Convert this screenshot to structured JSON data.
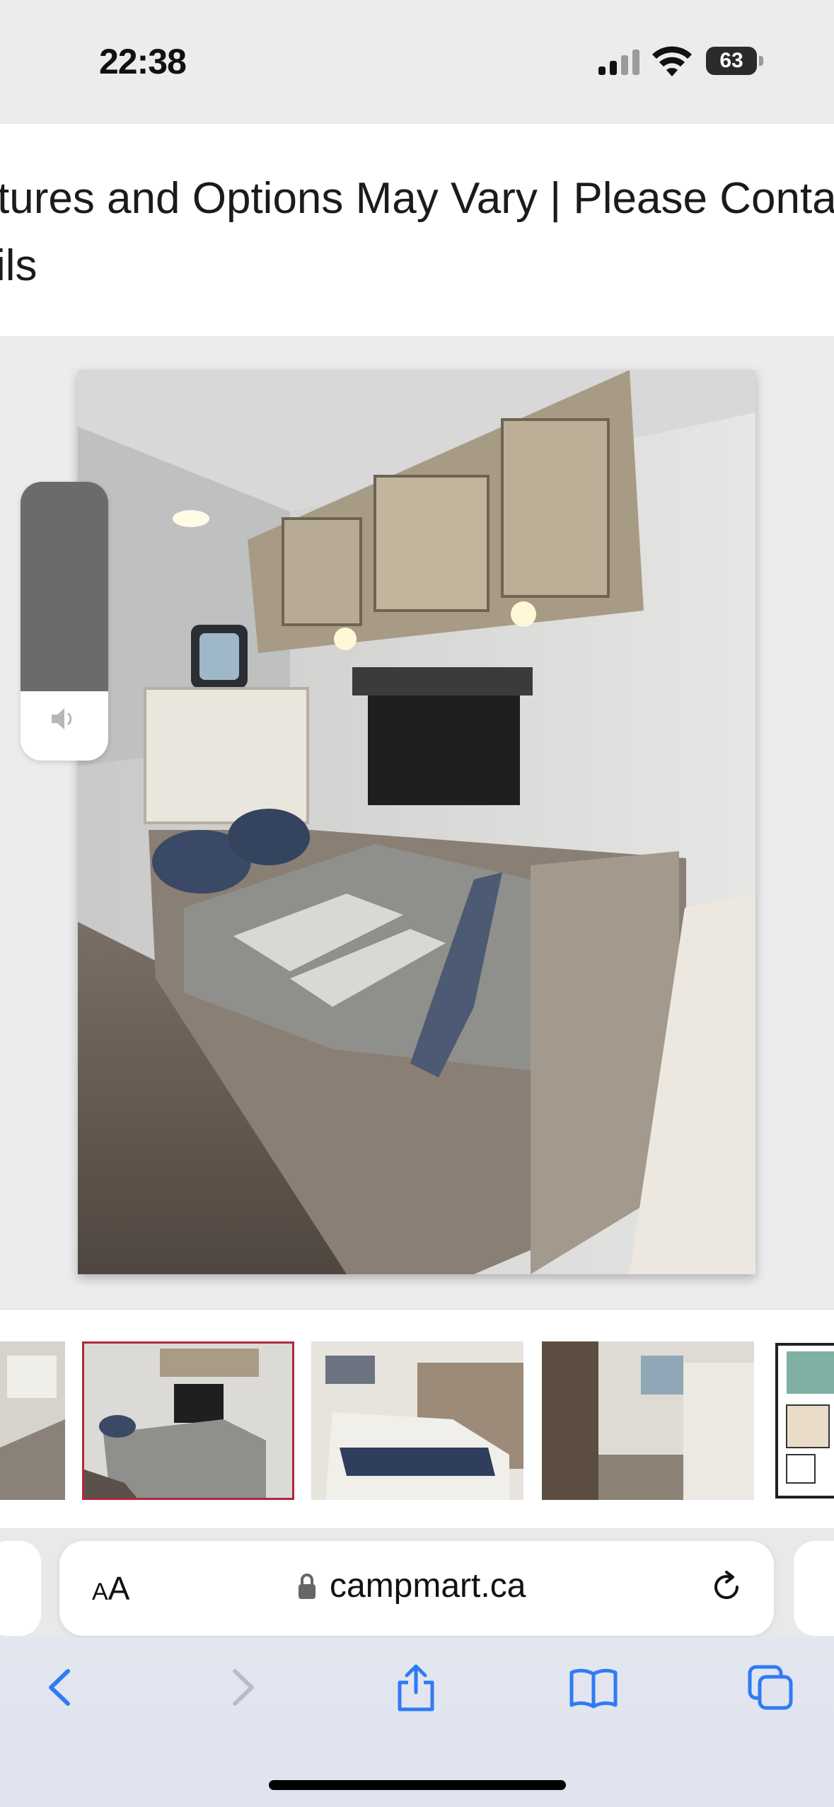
{
  "status_bar": {
    "time": "22:38",
    "battery_level": "63"
  },
  "banner": {
    "line1": "tures and Options May Vary | Please Contact",
    "line2": "ils"
  },
  "volume_hud": {
    "level": 0.75
  },
  "gallery": {
    "selected_index": 1,
    "thumbnail_count": 5
  },
  "url_bar": {
    "reader_label_small": "A",
    "reader_label_large": "A",
    "url": "campmart.ca"
  },
  "colors": {
    "accent": "#2f7bf6",
    "selected_border": "#b0283a",
    "disabled": "#b9bcc6"
  }
}
